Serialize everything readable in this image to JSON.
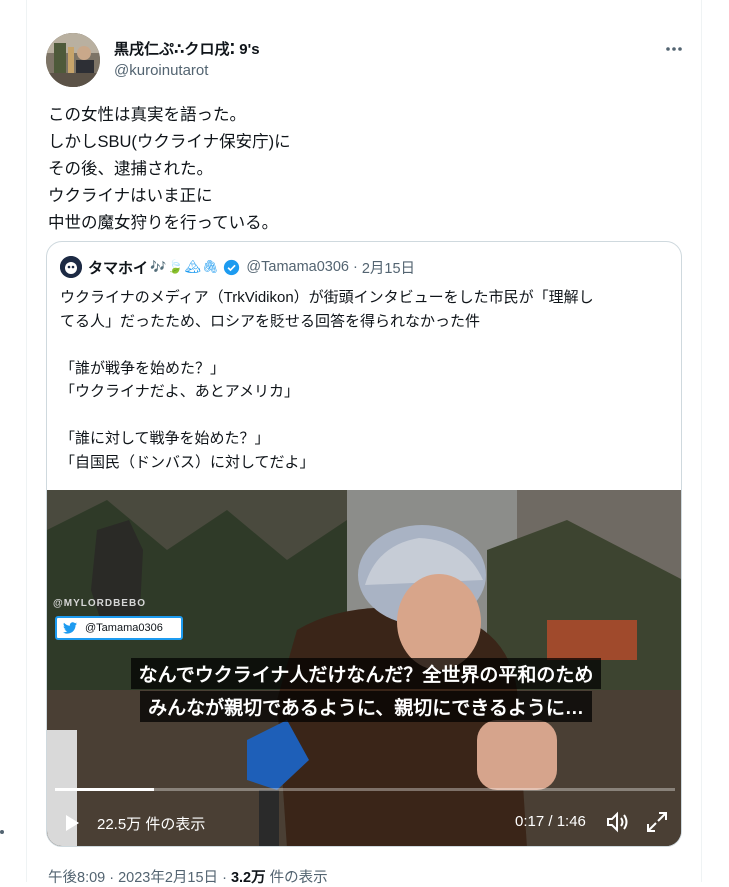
{
  "tweet": {
    "author_name": "黒戌仁ぷ∴クロ戌⁚ 9's",
    "author_handle": "@kuroinutarot",
    "text_lines": [
      "この女性は真実を語った。",
      "しかしSBU(ウクライナ保安庁)に",
      "その後、逮捕された。",
      "ウクライナはいま正に",
      "中世の魔女狩りを行っている。"
    ],
    "footer": {
      "time": "午後8:09 · 2023年2月15日 · ",
      "views_count": "3.2万",
      "views_label": " 件の表示"
    }
  },
  "quote": {
    "author_name": "タマホイ",
    "author_emoji": "🎶🍃🏔🖇",
    "author_handle": "@Tamama0306",
    "separator": "·",
    "date": "2月15日",
    "text_lines": [
      "ウクライナのメディア（TrkVidikon）が街頭インタビューをした市民が「理解し",
      "てる人」だったため、ロシアを貶せる回答を得られなかった件",
      "",
      "「誰が戦争を始めた？」",
      "「ウクライナだよ、あとアメリカ」",
      "",
      "「誰に対して戦争を始めた？」",
      "「自国民（ドンバス）に対してだよ」"
    ]
  },
  "video": {
    "watermark": "@MYLORDBEBO",
    "badge_handle": "@Tamama0306",
    "subtitle_line1": "なんでウクライナ人だけなんだ？全世界の平和のため",
    "subtitle_line2": "みんなが親切であるように、親切にできるように…",
    "views": "22.5万 件の表示",
    "time": "0:17 / 1:46",
    "progress": 0.16
  },
  "colors": {
    "accent": "#1d9bf0",
    "text_primary": "#0f1419",
    "text_secondary": "#536471",
    "border": "#cfd9de"
  },
  "icons": [
    "more-icon",
    "verified-icon",
    "twitter-bird-icon",
    "play-icon",
    "volume-icon",
    "fullscreen-icon"
  ]
}
